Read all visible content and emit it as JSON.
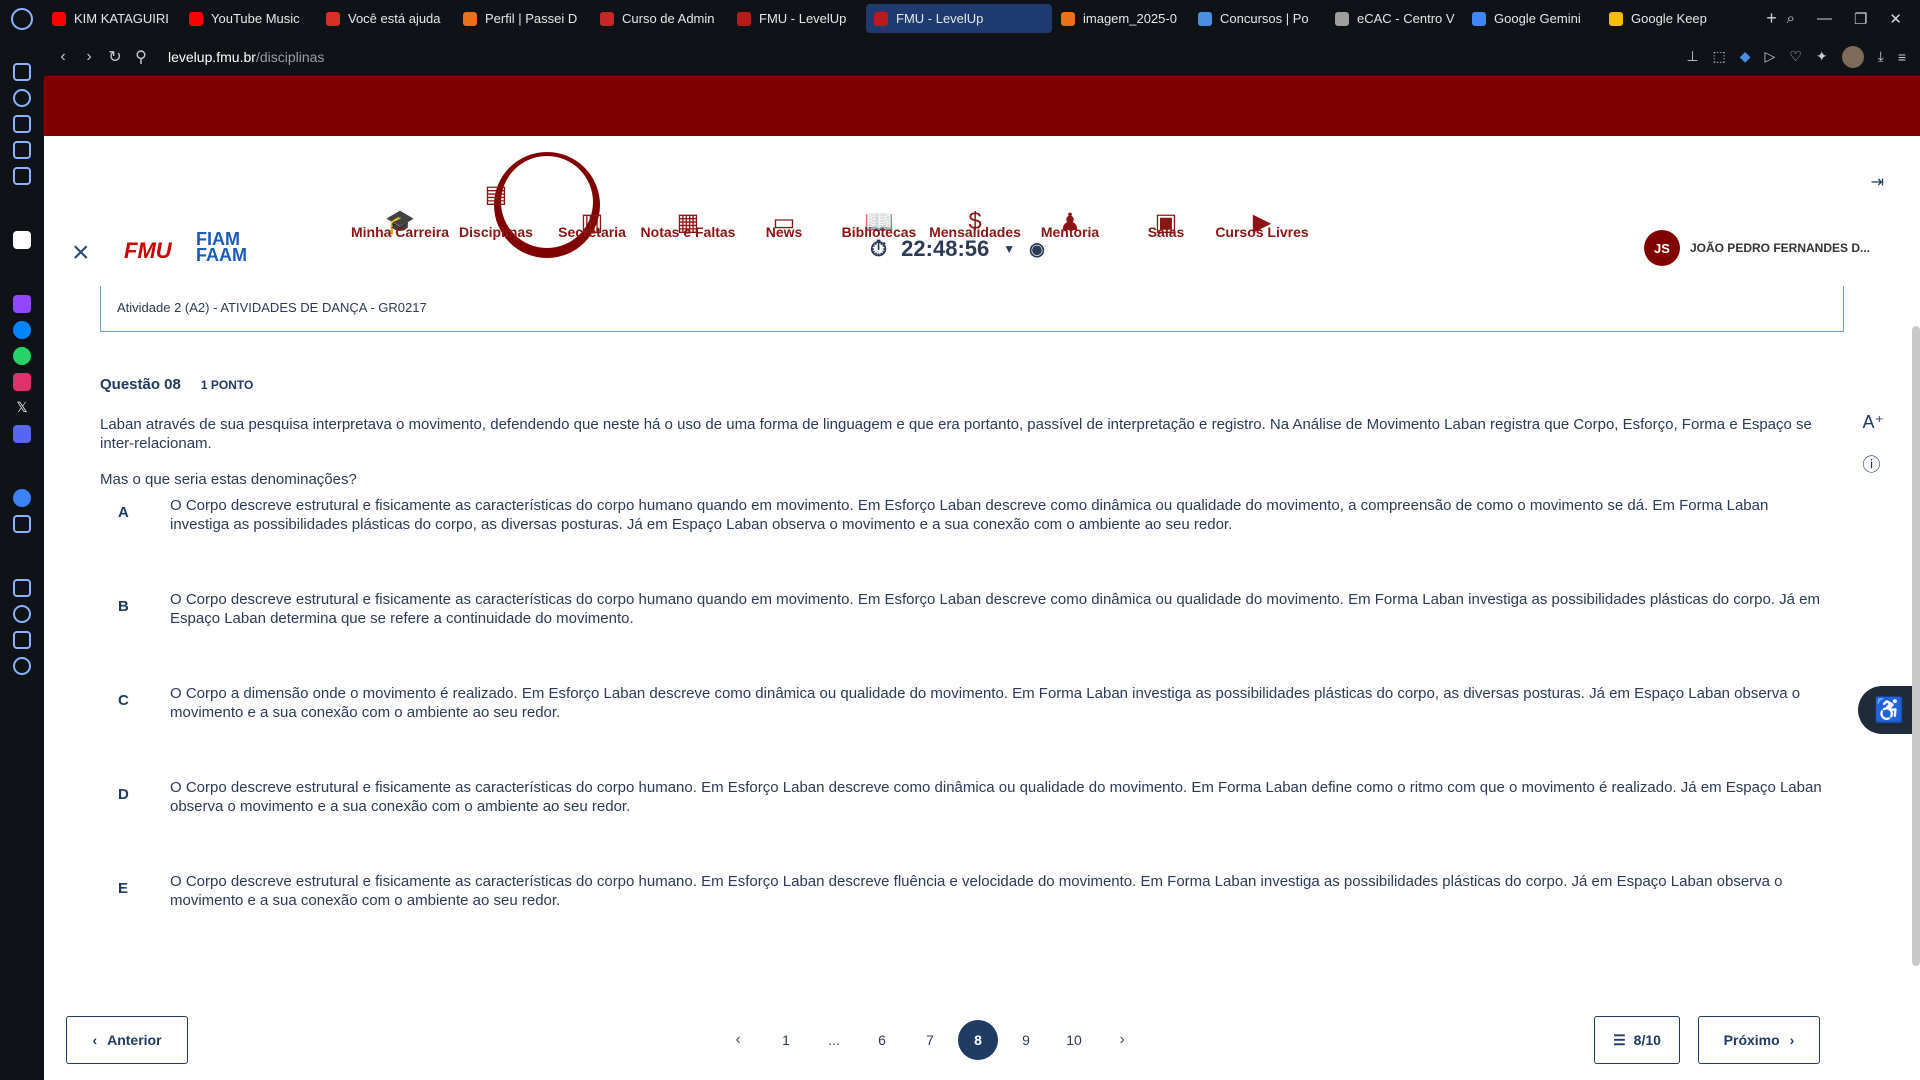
{
  "browser": {
    "tabs": [
      {
        "label": "KIM KATAGUIRI",
        "color": "#ff0000",
        "active": false
      },
      {
        "label": "YouTube Music",
        "color": "#ff0000",
        "active": false
      },
      {
        "label": "Você está ajuda",
        "color": "#d93025",
        "active": false
      },
      {
        "label": "Perfil | Passei D",
        "color": "#e8711a",
        "active": false
      },
      {
        "label": "Curso de Admin",
        "color": "#c62828",
        "active": false
      },
      {
        "label": "FMU - LevelUp",
        "color": "#b71c1c",
        "active": false
      },
      {
        "label": "FMU - LevelUp",
        "color": "#b71c1c",
        "active": true
      },
      {
        "label": "imagem_2025-0",
        "color": "#e8711a",
        "active": false
      },
      {
        "label": "Concursos | Po",
        "color": "#4a90e2",
        "active": false
      },
      {
        "label": "eCAC - Centro V",
        "color": "#9e9e9e",
        "active": false
      },
      {
        "label": "Google Gemini",
        "color": "#4285f4",
        "active": false
      },
      {
        "label": "Google Keep",
        "color": "#fbbc04",
        "active": false
      }
    ],
    "url_domain": "levelup.fmu.br",
    "url_path": "/disciplinas",
    "new_tab": "+"
  },
  "nav": {
    "items": [
      {
        "label": "Minha Carreira",
        "icon": "graduation-cap-icon",
        "glyph": "🎓"
      },
      {
        "label": "Disciplinas",
        "icon": "document-icon",
        "glyph": "▤"
      },
      {
        "label": "Secretaria",
        "icon": "building-icon",
        "glyph": "▥"
      },
      {
        "label": "Notas e Faltas",
        "icon": "grades-icon",
        "glyph": "▦"
      },
      {
        "label": "News",
        "icon": "monitor-icon",
        "glyph": "▭"
      },
      {
        "label": "Bibliotecas",
        "icon": "book-icon",
        "glyph": "📖"
      },
      {
        "label": "Mensalidades",
        "icon": "dollar-icon",
        "glyph": "$"
      },
      {
        "label": "Mentoria",
        "icon": "mentor-icon",
        "glyph": "♟"
      },
      {
        "label": "Salas",
        "icon": "classroom-icon",
        "glyph": "▣"
      },
      {
        "label": "Cursos Livres",
        "icon": "play-icon",
        "glyph": "▶"
      }
    ],
    "active_index": 1
  },
  "exam": {
    "logo_fmu": "FMU",
    "logo_fiam": "FIAM",
    "logo_faam": "FAAM",
    "timer": "22:48:56",
    "user_initials": "JS",
    "user_name": "JOÃO PEDRO FERNANDES D...",
    "activity_title": "Atividade 2 (A2) - ATIVIDADES DE DANÇA - GR0217"
  },
  "question": {
    "number": "Questão 08",
    "points": "1 PONTO",
    "text": "Laban através de sua pesquisa interpretava o movimento, defendendo que neste há o uso de uma forma de linguagem e que era portanto, passível de interpretação e registro. Na Análise de Movimento Laban registra que Corpo, Esforço, Forma e Espaço se inter-relacionam.",
    "sub": "Mas o que seria estas denominações?",
    "options": [
      {
        "letter": "A",
        "text": "O Corpo descreve estrutural e fisicamente as características do corpo humano quando em movimento. Em Esforço Laban descreve como dinâmica ou qualidade do movimento, a compreensão de como o movimento se dá. Em Forma Laban investiga as possibilidades plásticas do corpo, as diversas posturas. Já em Espaço Laban observa o movimento e a sua conexão com o ambiente ao seu redor."
      },
      {
        "letter": "B",
        "text": "O Corpo descreve estrutural e fisicamente as características do corpo humano quando em movimento. Em Esforço Laban descreve como dinâmica ou qualidade do movimento. Em Forma Laban investiga as possibilidades plásticas do corpo. Já em Espaço Laban determina que se refere a continuidade do movimento."
      },
      {
        "letter": "C",
        "text": "O Corpo a dimensão onde o movimento é realizado. Em Esforço Laban descreve como dinâmica ou qualidade do movimento. Em Forma Laban investiga as possibilidades plásticas do corpo, as diversas posturas. Já em Espaço Laban observa o movimento e a sua conexão com o ambiente ao seu redor."
      },
      {
        "letter": "D",
        "text": "O Corpo descreve estrutural e fisicamente as características do corpo humano. Em Esforço Laban descreve como dinâmica ou qualidade do movimento. Em Forma Laban define como o ritmo com que o movimento é realizado. Já em Espaço Laban observa o movimento e a sua conexão com o ambiente ao seu redor."
      },
      {
        "letter": "E",
        "text": "O Corpo descreve estrutural e fisicamente as características do corpo humano. Em Esforço Laban descreve fluência e velocidade do movimento. Em Forma Laban investiga as possibilidades plásticas do corpo. Já em Espaço Laban observa o movimento e a sua conexão com o ambiente ao seu redor."
      }
    ]
  },
  "footer": {
    "prev_label": "Anterior",
    "next_label": "Próximo",
    "count_label": "8/10",
    "pages": [
      "1",
      "...",
      "6",
      "7",
      "8",
      "9",
      "10"
    ],
    "active_page": "8"
  },
  "colors": {
    "brand_red": "#800000",
    "primary_blue": "#1f3a63"
  }
}
